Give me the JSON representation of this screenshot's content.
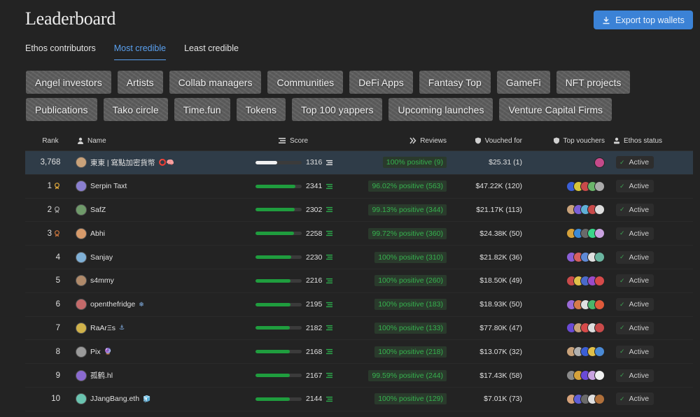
{
  "header": {
    "title": "Leaderboard",
    "export_label": "Export top wallets"
  },
  "tabs": [
    {
      "label": "Ethos contributors",
      "active": false
    },
    {
      "label": "Most credible",
      "active": true
    },
    {
      "label": "Least credible",
      "active": false
    }
  ],
  "chips_row1": [
    "Angel investors",
    "Artists",
    "Collab managers",
    "Communities",
    "DeFi Apps",
    "Fantasy Top",
    "GameFi",
    "NFT projects"
  ],
  "chips_row2": [
    "Publications",
    "Tako circle",
    "Time.fun",
    "Tokens",
    "Top 100 yappers",
    "Upcoming launches",
    "Venture Capital Firms"
  ],
  "columns": {
    "rank": "Rank",
    "name": "Name",
    "score": "Score",
    "reviews": "Reviews",
    "vouched": "Vouched for",
    "voucher": "Top vouchers",
    "status": "Ethos status"
  },
  "colors": {
    "accent": "#3b82d6",
    "positive": "#36b14e",
    "bar": "#1f9d3e",
    "highlight_row": "#2f3c48"
  },
  "rows": [
    {
      "rank": "3,768",
      "name": "東東 | 寫點加密貨幣",
      "score": "1316",
      "score_fill": 0.47,
      "reviews": "100% positive (9)",
      "vouched": "$25.31 (1)",
      "status": "Active",
      "me": true,
      "icon": "⭕🧠",
      "medal": ""
    },
    {
      "rank": "1",
      "name": "Serpin Taxt",
      "score": "2341",
      "score_fill": 0.86,
      "reviews": "96.02% positive (563)",
      "vouched": "$47.22K (120)",
      "status": "Active",
      "me": false,
      "icon": "",
      "medal": "gold"
    },
    {
      "rank": "2",
      "name": "SafZ",
      "score": "2302",
      "score_fill": 0.85,
      "reviews": "99.13% positive (344)",
      "vouched": "$21.17K (113)",
      "status": "Active",
      "me": false,
      "icon": "",
      "medal": "silver"
    },
    {
      "rank": "3",
      "name": "Abhi",
      "score": "2258",
      "score_fill": 0.84,
      "reviews": "99.72% positive (360)",
      "vouched": "$24.38K (50)",
      "status": "Active",
      "me": false,
      "icon": "",
      "medal": "bronze"
    },
    {
      "rank": "4",
      "name": "Sanjay",
      "score": "2230",
      "score_fill": 0.77,
      "reviews": "100% positive (310)",
      "vouched": "$21.82K (36)",
      "status": "Active",
      "me": false,
      "icon": "",
      "medal": ""
    },
    {
      "rank": "5",
      "name": "s4mmy",
      "score": "2216",
      "score_fill": 0.76,
      "reviews": "100% positive (260)",
      "vouched": "$18.50K (49)",
      "status": "Active",
      "me": false,
      "icon": "",
      "medal": ""
    },
    {
      "rank": "6",
      "name": "openthefridge",
      "score": "2195",
      "score_fill": 0.75,
      "reviews": "100% positive (183)",
      "vouched": "$18.93K (50)",
      "status": "Active",
      "me": false,
      "icon": "❄",
      "medal": ""
    },
    {
      "rank": "7",
      "name": "RaArΞs",
      "score": "2182",
      "score_fill": 0.74,
      "reviews": "100% positive (133)",
      "vouched": "$77.80K (47)",
      "status": "Active",
      "me": false,
      "icon": "⚓",
      "medal": ""
    },
    {
      "rank": "8",
      "name": "Pix",
      "score": "2168",
      "score_fill": 0.74,
      "reviews": "100% positive (218)",
      "vouched": "$13.07K (32)",
      "status": "Active",
      "me": false,
      "icon": "🔮",
      "medal": ""
    },
    {
      "rank": "9",
      "name": "孤鹤.hl",
      "score": "2167",
      "score_fill": 0.74,
      "reviews": "99.59% positive (244)",
      "vouched": "$17.43K (58)",
      "status": "Active",
      "me": false,
      "icon": "",
      "medal": ""
    },
    {
      "rank": "10",
      "name": "JJangBang.eth",
      "score": "2144",
      "score_fill": 0.74,
      "reviews": "100% positive (129)",
      "vouched": "$7.01K (73)",
      "status": "Active",
      "me": false,
      "icon": "🧊",
      "medal": ""
    }
  ]
}
